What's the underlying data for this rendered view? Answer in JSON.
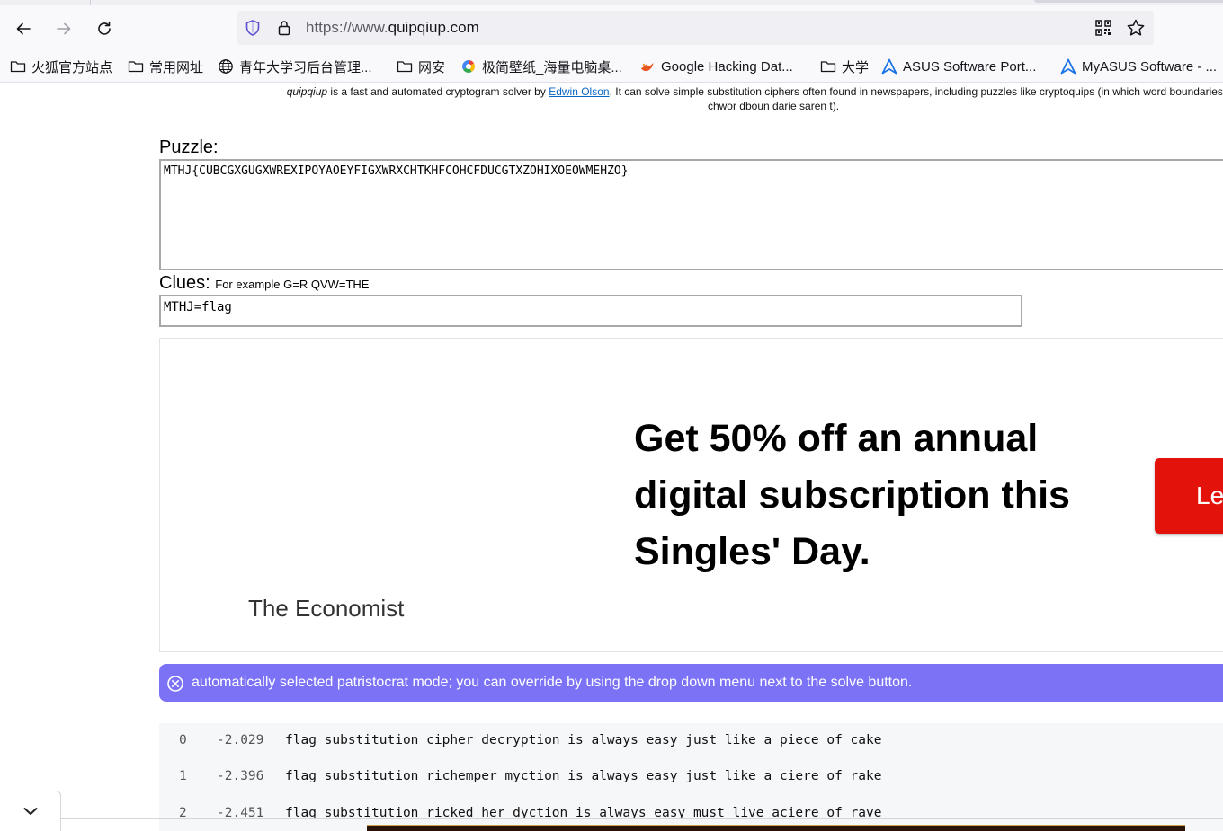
{
  "browser": {
    "url_prefix": "https://www.",
    "url_domain": "quipqiup.com",
    "bookmarks": [
      {
        "label": "火狐官方站点",
        "icon": "folder-icon"
      },
      {
        "label": "常用网址",
        "icon": "folder-icon"
      },
      {
        "label": "青年大学习后台管理...",
        "icon": "globe-icon"
      },
      {
        "label": "网安",
        "icon": "folder-icon"
      },
      {
        "label": "极简壁纸_海量电脑桌...",
        "icon": "colorful-ring-icon"
      },
      {
        "label": "Google Hacking Dat...",
        "icon": "flame-icon"
      },
      {
        "label": "大学",
        "icon": "folder-icon"
      },
      {
        "label": "ASUS Software Port...",
        "icon": "asus-icon"
      },
      {
        "label": "MyASUS Software - ...",
        "icon": "asus-icon"
      }
    ]
  },
  "page": {
    "intro_name": "quipqiup",
    "intro_text1": " is a fast and automated cryptogram solver by ",
    "intro_link": "Edwin Olson",
    "intro_text2": ". It can solve simple substitution ciphers often found in newspapers, including puzzles like cryptoquips (in which word boundaries are pre",
    "intro_line2": "chwor dboun darie saren t).",
    "puzzle_label": "Puzzle:",
    "puzzle_value": "MTHJ{CUBCGXGUGXWREXIPOYAOEYFIGXWRXCHTKHFCOHCFDUCGTXZOHIXOEOWMEHZO}",
    "clues_label": "Clues:",
    "clues_hint": "For example G=R QVW=THE",
    "clues_value": "MTHJ=flag"
  },
  "ad": {
    "brand": "The Economist",
    "headline": "Get 50% off an annual digital subscription this Singles' Day.",
    "cta_label": "Le",
    "cta_color": "#e3120b"
  },
  "notice": {
    "text": "automatically selected patristocrat mode; you can override by using the drop down menu next to the solve button.",
    "color": "#7b72f5"
  },
  "results": [
    {
      "index": "0",
      "score": "-2.029",
      "text": "flag substitution cipher decryption is always easy just like a piece of cake"
    },
    {
      "index": "1",
      "score": "-2.396",
      "text": "flag substitution richemper myction is always easy just like a ciere of rake"
    },
    {
      "index": "2",
      "score": "-2.451",
      "text": "flag substitution ricked her dyction is always easy must live aciere of rave"
    }
  ]
}
